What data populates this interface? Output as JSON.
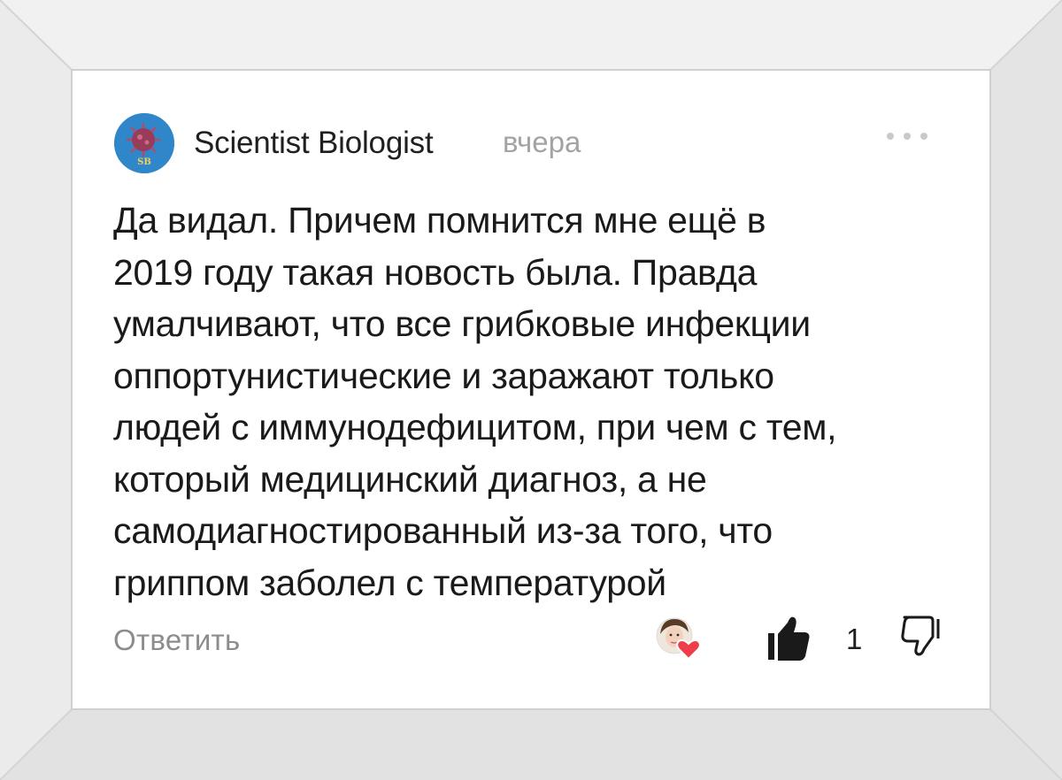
{
  "comment": {
    "author": "Scientist Biologist",
    "avatar_text": "SB",
    "time": "вчера",
    "text": "Да видал. Причем помнится мне ещё в\n2019 году такая новость была. Правда\nумалчивают, что все грибковые инфекции\nоппортунистические и заражают только\nлюдей с иммунодефицитом, при чем с тем,\nкоторый медицинский диагноз, а не\nсамодиагностированный из-за того, что\nгриппом заболел с температурой",
    "reply_label": "Ответить",
    "like_count": "1"
  },
  "icons": {
    "more": "more-dots-icon",
    "like": "thumbs-up-icon",
    "dislike": "thumbs-down-icon",
    "reaction": "heart-icon"
  },
  "colors": {
    "avatar_bg": "#2f86c8",
    "heart": "#ef3e4a",
    "muted": "#a3a3a3"
  }
}
